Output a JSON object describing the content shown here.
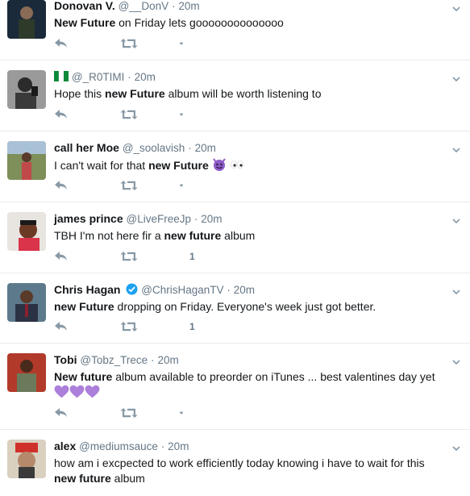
{
  "tweets": [
    {
      "name": "Donovan V.",
      "handle": "@__DonV",
      "time": "20m",
      "text_pre": "",
      "text_bold1": "New Future",
      "text_mid": " on Friday lets goooooooooooooo",
      "text_bold2": "",
      "text_post": "",
      "likes": ""
    },
    {
      "name": "",
      "flag": "nigeria-flag",
      "handle": "@_R0TIMI",
      "time": "20m",
      "text_pre": "Hope this ",
      "text_bold1": "new Future",
      "text_mid": " album will be worth listening to",
      "text_bold2": "",
      "text_post": "",
      "likes": ""
    },
    {
      "name": "call her Moe",
      "handle": "@_soolavish",
      "time": "20m",
      "text_pre": "I can't wait for that ",
      "text_bold1": "new Future",
      "text_mid": "",
      "text_bold2": "",
      "text_post": "",
      "emoji": [
        "smiling-imp-emoji",
        "eyes-emoji"
      ],
      "likes": ""
    },
    {
      "name": "james prince",
      "handle": "@LiveFreeJp",
      "time": "20m",
      "text_pre": "TBH I'm not here fir a ",
      "text_bold1": "new future",
      "text_mid": " album",
      "text_bold2": "",
      "text_post": "",
      "likes": "1"
    },
    {
      "name": "Chris Hagan",
      "verified": true,
      "handle": "@ChrisHaganTV",
      "time": "20m",
      "text_pre": "",
      "text_bold1": "new Future",
      "text_mid": " dropping on Friday. Everyone's week just got better.",
      "text_bold2": "",
      "text_post": "",
      "likes": "1"
    },
    {
      "name": "Tobi",
      "handle": "@Tobz_Trece",
      "time": "20m",
      "text_pre": "",
      "text_bold1": "New future",
      "text_mid": " album available to preorder on iTunes ... best valentines day yet",
      "text_bold2": "",
      "text_post": "",
      "emoji": [
        "purple-heart-emoji",
        "purple-heart-emoji",
        "purple-heart-emoji"
      ],
      "likes": ""
    },
    {
      "name": "alex",
      "handle": "@mediumsauce",
      "time": "20m",
      "text_pre": "how am i excpected to work efficiently today knowing i have to wait for this ",
      "text_bold1": "new",
      "text_mid": " ",
      "text_bold2": "future",
      "text_post": " album",
      "likes": ""
    }
  ],
  "separator": "·",
  "colors": {
    "text": "#14171a",
    "secondary": "#657786",
    "icon": "#8899a6",
    "border": "#e6ecf0",
    "verified": "#1da1f2",
    "purple_heart": "#ab7fdb"
  }
}
